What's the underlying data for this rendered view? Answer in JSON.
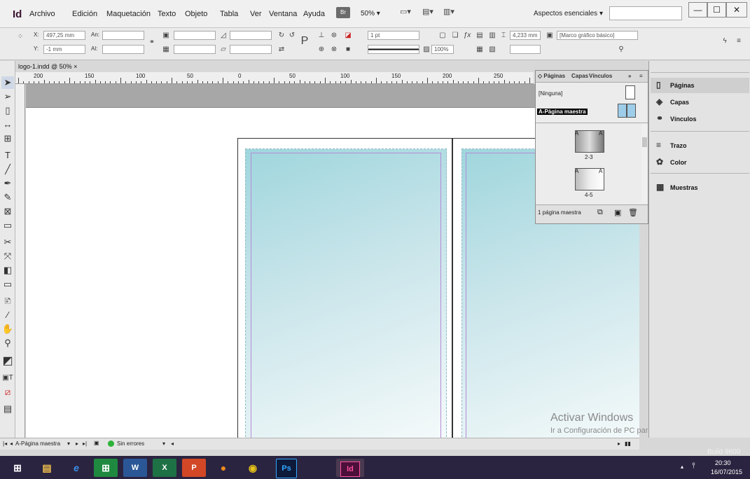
{
  "app": {
    "logo": "Id",
    "menu": [
      "Archivo",
      "Edición",
      "Maquetación",
      "Texto",
      "Objeto",
      "Tabla",
      "Ver",
      "Ventana",
      "Ayuda"
    ],
    "br_label": "Br",
    "zoom": "50% ▾",
    "workspace": "Aspectos esenciales ▾",
    "window_buttons": [
      "—",
      "☐",
      "✕"
    ]
  },
  "control": {
    "x_label": "X:",
    "x_value": "497,25 mm",
    "y_label": "Y:",
    "y_value": "-1 mm",
    "w_label": "An:",
    "h_label": "Al:",
    "stroke_weight": "1 pt",
    "opacity": "100%",
    "dim_value": "4,233 mm",
    "frame_style": "[Marco gráfico básico]"
  },
  "document": {
    "tab_label": "logo-1.indd @ 50%  ×",
    "ruler_labels": [
      "200",
      "150",
      "100",
      "50",
      "0",
      "50",
      "100",
      "150",
      "200",
      "250"
    ]
  },
  "statusbar": {
    "page": "A-Página maestra",
    "errors": "Sin errores"
  },
  "pages_panel": {
    "tabs": [
      "◇ Páginas",
      "Capas",
      "Vínculos"
    ],
    "master_none": "[Ninguna]",
    "master_a": "A-Página maestra",
    "spread1": "2-3",
    "spread2": "4-5",
    "spread_prefix": "A",
    "footer": "1 página maestra"
  },
  "dock": {
    "items": [
      {
        "label": "Páginas",
        "icon": "pages-icon"
      },
      {
        "label": "Capas",
        "icon": "layers-icon"
      },
      {
        "label": "Vínculos",
        "icon": "links-icon"
      },
      {
        "label": "Trazo",
        "icon": "stroke-icon"
      },
      {
        "label": "Color",
        "icon": "color-icon"
      },
      {
        "label": "Muestras",
        "icon": "swatches-icon"
      }
    ]
  },
  "watermark": {
    "title": "Activar Windows",
    "subtitle": "Ir a Configuración de PC para activar Windows."
  },
  "build": "Build 9600",
  "taskbar": {
    "time": "20:30",
    "date": "16/07/2015",
    "ps_label": "Ps",
    "id_label": "Id",
    "word_label": "W",
    "excel_label": "X",
    "ppt_label": "P"
  }
}
